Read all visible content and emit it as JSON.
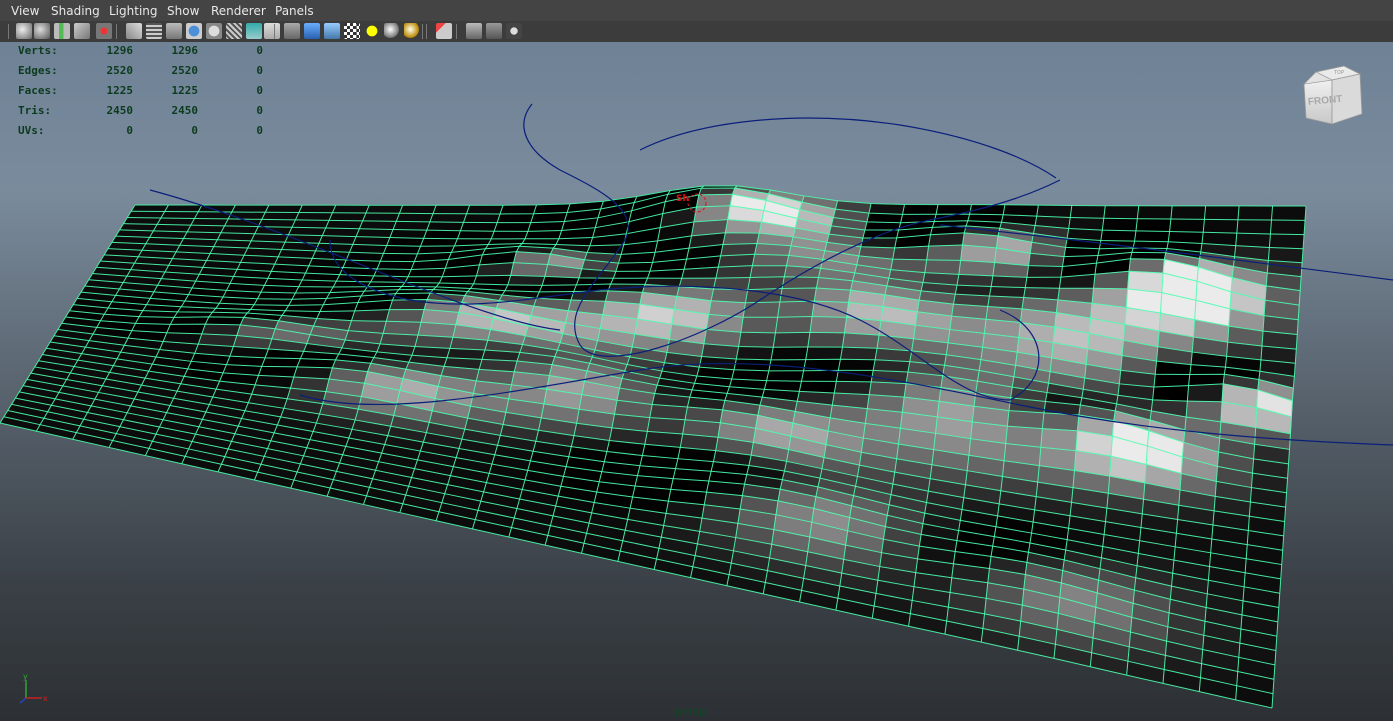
{
  "menu": [
    "View",
    "Shading",
    "Lighting",
    "Show",
    "Renderer",
    "Panels"
  ],
  "toolbar": {
    "icons": [
      "select-camera-icon",
      "camera-attributes-icon",
      "bookmarks-icon",
      "image-plane-icon",
      "2d-pan-zoom-icon",
      "grease-pencil-icon",
      "grid-icon",
      "film-gate-icon",
      "resolution-gate-icon",
      "gate-mask-icon",
      "field-chart-icon",
      "safe-action-icon",
      "safe-title-icon",
      "wireframe-icon",
      "smooth-shade-icon",
      "bounding-box-icon",
      "textured-icon",
      "use-all-lights-icon",
      "shadows-icon",
      "ambient-occlusion-icon",
      "isolate-select-icon",
      "xray-icon",
      "xray-joints-icon",
      "share-icon"
    ]
  },
  "hud": {
    "rows": [
      {
        "label": "Verts:",
        "v1": "1296",
        "v2": "1296",
        "v3": "0"
      },
      {
        "label": "Edges:",
        "v1": "2520",
        "v2": "2520",
        "v3": "0"
      },
      {
        "label": "Faces:",
        "v1": "1225",
        "v2": "1225",
        "v3": "0"
      },
      {
        "label": "Tris:",
        "v1": "2450",
        "v2": "2450",
        "v3": "0"
      },
      {
        "label": "UVs:",
        "v1": "0",
        "v2": "0",
        "v3": "0"
      }
    ]
  },
  "viewcube": {
    "front": "FRONT",
    "top": "TOP"
  },
  "camera_name": "persp",
  "axis": {
    "y": "y",
    "x": "x"
  },
  "pivot_label": "Sh",
  "colors": {
    "wire": "#4dffb0",
    "curve": "#0a1f7a",
    "pivot": "#dd1111",
    "hud_text": "#0d3b1e"
  }
}
